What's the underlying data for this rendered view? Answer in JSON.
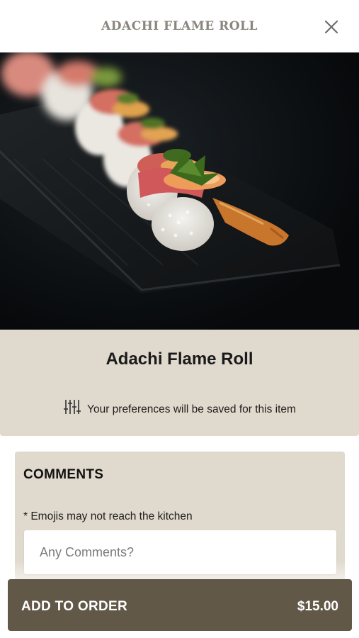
{
  "header": {
    "title": "ADACHI FLAME ROLL",
    "close_icon": "close-icon"
  },
  "photo": {
    "subject": "sushi-roll-photo"
  },
  "item": {
    "name": "Adachi Flame Roll",
    "preferences_note": "Your preferences will be saved for this item",
    "preferences_icon": "sliders-icon"
  },
  "comments": {
    "heading": "COMMENTS",
    "note": "* Emojis may not reach the kitchen",
    "placeholder": "Any Comments?",
    "value": ""
  },
  "order_button": {
    "label": "ADD TO ORDER",
    "price": "$15.00"
  },
  "colors": {
    "card_bg": "#e0d9cd",
    "button_bg": "#625848",
    "header_text": "#8a857d"
  }
}
